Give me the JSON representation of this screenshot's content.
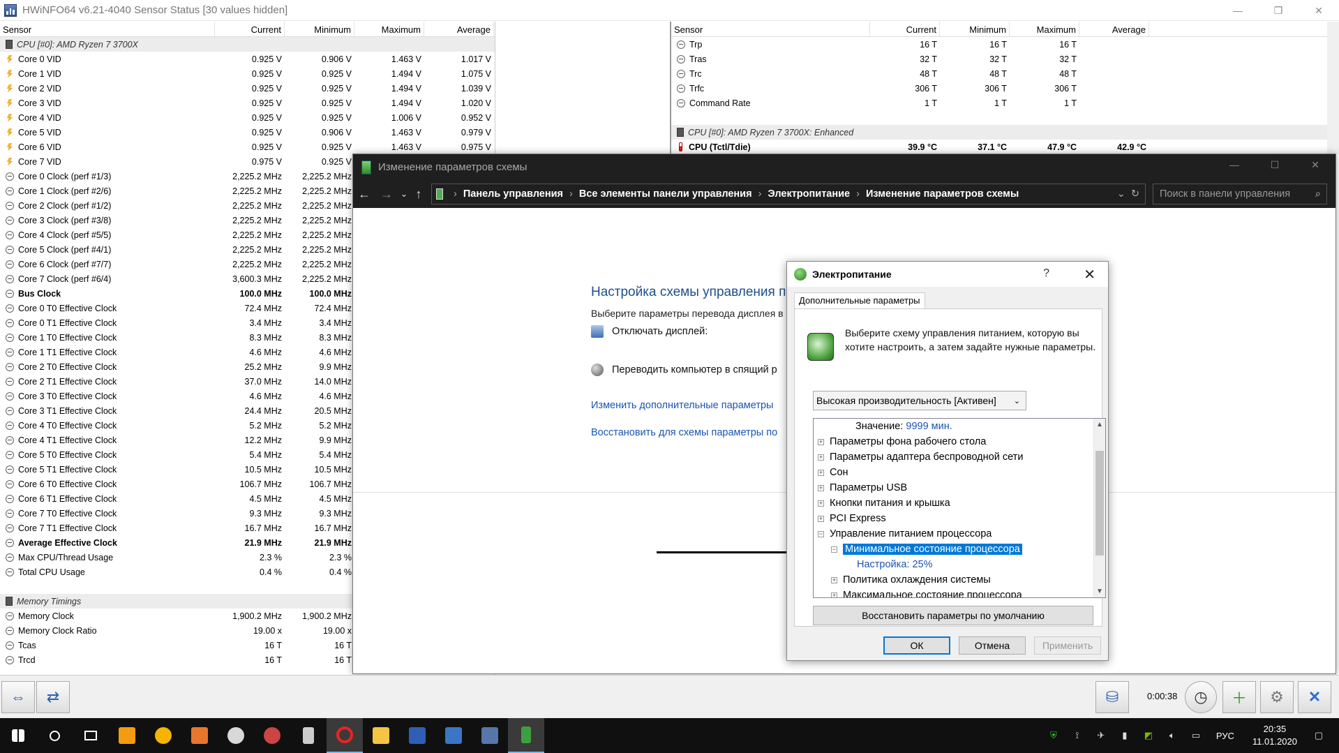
{
  "hwinfo": {
    "title": "HWiNFO64 v6.21-4040 Sensor Status [30 values hidden]",
    "headers": [
      "Sensor",
      "Current",
      "Minimum",
      "Maximum",
      "Average"
    ],
    "left_rows": [
      {
        "kind": "group",
        "icon": "chip",
        "name": "CPU [#0]: AMD Ryzen 7 3700X",
        "cur": "",
        "min": "",
        "max": "",
        "avg": ""
      },
      {
        "kind": "row",
        "icon": "bolt",
        "name": "Core 0 VID",
        "cur": "0.925 V",
        "min": "0.906 V",
        "max": "1.463 V",
        "avg": "1.017 V"
      },
      {
        "kind": "row",
        "icon": "bolt",
        "name": "Core 1 VID",
        "cur": "0.925 V",
        "min": "0.925 V",
        "max": "1.494 V",
        "avg": "1.075 V"
      },
      {
        "kind": "row",
        "icon": "bolt",
        "name": "Core 2 VID",
        "cur": "0.925 V",
        "min": "0.925 V",
        "max": "1.494 V",
        "avg": "1.039 V"
      },
      {
        "kind": "row",
        "icon": "bolt",
        "name": "Core 3 VID",
        "cur": "0.925 V",
        "min": "0.925 V",
        "max": "1.494 V",
        "avg": "1.020 V"
      },
      {
        "kind": "row",
        "icon": "bolt",
        "name": "Core 4 VID",
        "cur": "0.925 V",
        "min": "0.925 V",
        "max": "1.006 V",
        "avg": "0.952 V"
      },
      {
        "kind": "row",
        "icon": "bolt",
        "name": "Core 5 VID",
        "cur": "0.925 V",
        "min": "0.906 V",
        "max": "1.463 V",
        "avg": "0.979 V"
      },
      {
        "kind": "row",
        "icon": "bolt",
        "name": "Core 6 VID",
        "cur": "0.925 V",
        "min": "0.925 V",
        "max": "1.463 V",
        "avg": "0.975 V"
      },
      {
        "kind": "row",
        "icon": "bolt",
        "name": "Core 7 VID",
        "cur": "0.975 V",
        "min": "0.925 V",
        "max": "",
        "avg": ""
      },
      {
        "kind": "row",
        "icon": "clock",
        "name": "Core 0 Clock (perf #1/3)",
        "cur": "2,225.2 MHz",
        "min": "2,225.2 MHz",
        "max": "",
        "avg": ""
      },
      {
        "kind": "row",
        "icon": "clock",
        "name": "Core 1 Clock (perf #2/6)",
        "cur": "2,225.2 MHz",
        "min": "2,225.2 MHz",
        "max": "",
        "avg": ""
      },
      {
        "kind": "row",
        "icon": "clock",
        "name": "Core 2 Clock (perf #1/2)",
        "cur": "2,225.2 MHz",
        "min": "2,225.2 MHz",
        "max": "",
        "avg": ""
      },
      {
        "kind": "row",
        "icon": "clock",
        "name": "Core 3 Clock (perf #3/8)",
        "cur": "2,225.2 MHz",
        "min": "2,225.2 MHz",
        "max": "",
        "avg": ""
      },
      {
        "kind": "row",
        "icon": "clock",
        "name": "Core 4 Clock (perf #5/5)",
        "cur": "2,225.2 MHz",
        "min": "2,225.2 MHz",
        "max": "",
        "avg": ""
      },
      {
        "kind": "row",
        "icon": "clock",
        "name": "Core 5 Clock (perf #4/1)",
        "cur": "2,225.2 MHz",
        "min": "2,225.2 MHz",
        "max": "",
        "avg": ""
      },
      {
        "kind": "row",
        "icon": "clock",
        "name": "Core 6 Clock (perf #7/7)",
        "cur": "2,225.2 MHz",
        "min": "2,225.2 MHz",
        "max": "",
        "avg": ""
      },
      {
        "kind": "row",
        "icon": "clock",
        "name": "Core 7 Clock (perf #6/4)",
        "cur": "3,600.3 MHz",
        "min": "2,225.2 MHz",
        "max": "",
        "avg": ""
      },
      {
        "kind": "bold",
        "icon": "clock",
        "name": "Bus Clock",
        "cur": "100.0 MHz",
        "min": "100.0 MHz",
        "max": "",
        "avg": ""
      },
      {
        "kind": "row",
        "icon": "clock",
        "name": "Core 0 T0 Effective Clock",
        "cur": "72.4 MHz",
        "min": "72.4 MHz",
        "max": "",
        "avg": ""
      },
      {
        "kind": "row",
        "icon": "clock",
        "name": "Core 0 T1 Effective Clock",
        "cur": "3.4 MHz",
        "min": "3.4 MHz",
        "max": "",
        "avg": ""
      },
      {
        "kind": "row",
        "icon": "clock",
        "name": "Core 1 T0 Effective Clock",
        "cur": "8.3 MHz",
        "min": "8.3 MHz",
        "max": "",
        "avg": ""
      },
      {
        "kind": "row",
        "icon": "clock",
        "name": "Core 1 T1 Effective Clock",
        "cur": "4.6 MHz",
        "min": "4.6 MHz",
        "max": "",
        "avg": ""
      },
      {
        "kind": "row",
        "icon": "clock",
        "name": "Core 2 T0 Effective Clock",
        "cur": "25.2 MHz",
        "min": "9.9 MHz",
        "max": "",
        "avg": ""
      },
      {
        "kind": "row",
        "icon": "clock",
        "name": "Core 2 T1 Effective Clock",
        "cur": "37.0 MHz",
        "min": "14.0 MHz",
        "max": "",
        "avg": ""
      },
      {
        "kind": "row",
        "icon": "clock",
        "name": "Core 3 T0 Effective Clock",
        "cur": "4.6 MHz",
        "min": "4.6 MHz",
        "max": "",
        "avg": ""
      },
      {
        "kind": "row",
        "icon": "clock",
        "name": "Core 3 T1 Effective Clock",
        "cur": "24.4 MHz",
        "min": "20.5 MHz",
        "max": "",
        "avg": ""
      },
      {
        "kind": "row",
        "icon": "clock",
        "name": "Core 4 T0 Effective Clock",
        "cur": "5.2 MHz",
        "min": "5.2 MHz",
        "max": "",
        "avg": ""
      },
      {
        "kind": "row",
        "icon": "clock",
        "name": "Core 4 T1 Effective Clock",
        "cur": "12.2 MHz",
        "min": "9.9 MHz",
        "max": "",
        "avg": ""
      },
      {
        "kind": "row",
        "icon": "clock",
        "name": "Core 5 T0 Effective Clock",
        "cur": "5.4 MHz",
        "min": "5.4 MHz",
        "max": "",
        "avg": ""
      },
      {
        "kind": "row",
        "icon": "clock",
        "name": "Core 5 T1 Effective Clock",
        "cur": "10.5 MHz",
        "min": "10.5 MHz",
        "max": "",
        "avg": ""
      },
      {
        "kind": "row",
        "icon": "clock",
        "name": "Core 6 T0 Effective Clock",
        "cur": "106.7 MHz",
        "min": "106.7 MHz",
        "max": "",
        "avg": ""
      },
      {
        "kind": "row",
        "icon": "clock",
        "name": "Core 6 T1 Effective Clock",
        "cur": "4.5 MHz",
        "min": "4.5 MHz",
        "max": "",
        "avg": ""
      },
      {
        "kind": "row",
        "icon": "clock",
        "name": "Core 7 T0 Effective Clock",
        "cur": "9.3 MHz",
        "min": "9.3 MHz",
        "max": "",
        "avg": ""
      },
      {
        "kind": "row",
        "icon": "clock",
        "name": "Core 7 T1 Effective Clock",
        "cur": "16.7 MHz",
        "min": "16.7 MHz",
        "max": "",
        "avg": ""
      },
      {
        "kind": "bold",
        "icon": "clock",
        "name": "Average Effective Clock",
        "cur": "21.9 MHz",
        "min": "21.9 MHz",
        "max": "",
        "avg": ""
      },
      {
        "kind": "row",
        "icon": "clock",
        "name": "Max CPU/Thread Usage",
        "cur": "2.3 %",
        "min": "2.3 %",
        "max": "",
        "avg": ""
      },
      {
        "kind": "row",
        "icon": "clock",
        "name": "Total CPU Usage",
        "cur": "0.4 %",
        "min": "0.4 %",
        "max": "",
        "avg": ""
      },
      {
        "kind": "blank",
        "icon": "",
        "name": "",
        "cur": "",
        "min": "",
        "max": "",
        "avg": ""
      },
      {
        "kind": "group",
        "icon": "chip",
        "name": "Memory Timings",
        "cur": "",
        "min": "",
        "max": "",
        "avg": ""
      },
      {
        "kind": "row",
        "icon": "clock",
        "name": "Memory Clock",
        "cur": "1,900.2 MHz",
        "min": "1,900.2 MHz",
        "max": "",
        "avg": ""
      },
      {
        "kind": "row",
        "icon": "clock",
        "name": "Memory Clock Ratio",
        "cur": "19.00 x",
        "min": "19.00 x",
        "max": "",
        "avg": ""
      },
      {
        "kind": "row",
        "icon": "clock",
        "name": "Tcas",
        "cur": "16 T",
        "min": "16 T",
        "max": "",
        "avg": ""
      },
      {
        "kind": "row",
        "icon": "clock",
        "name": "Trcd",
        "cur": "16 T",
        "min": "16 T",
        "max": "",
        "avg": ""
      }
    ],
    "right_rows": [
      {
        "kind": "row",
        "icon": "clock",
        "name": "Trp",
        "cur": "16 T",
        "min": "16 T",
        "max": "16 T",
        "avg": ""
      },
      {
        "kind": "row",
        "icon": "clock",
        "name": "Tras",
        "cur": "32 T",
        "min": "32 T",
        "max": "32 T",
        "avg": ""
      },
      {
        "kind": "row",
        "icon": "clock",
        "name": "Trc",
        "cur": "48 T",
        "min": "48 T",
        "max": "48 T",
        "avg": ""
      },
      {
        "kind": "row",
        "icon": "clock",
        "name": "Trfc",
        "cur": "306 T",
        "min": "306 T",
        "max": "306 T",
        "avg": ""
      },
      {
        "kind": "row",
        "icon": "clock",
        "name": "Command Rate",
        "cur": "1 T",
        "min": "1 T",
        "max": "1 T",
        "avg": ""
      },
      {
        "kind": "blank",
        "icon": "",
        "name": "",
        "cur": "",
        "min": "",
        "max": "",
        "avg": ""
      },
      {
        "kind": "group",
        "icon": "chip",
        "name": "CPU [#0]: AMD Ryzen 7 3700X: Enhanced",
        "cur": "",
        "min": "",
        "max": "",
        "avg": ""
      },
      {
        "kind": "bold",
        "icon": "therm",
        "name": "CPU (Tctl/Tdie)",
        "cur": "39.9 °C",
        "min": "37.1 °C",
        "max": "47.9 °C",
        "avg": "42.9 °C"
      }
    ],
    "status_time": "0:00:38"
  },
  "control_panel": {
    "title": "Изменение параметров схемы",
    "breadcrumb": [
      "Панель управления",
      "Все элементы панели управления",
      "Электропитание",
      "Изменение параметров схемы"
    ],
    "search_placeholder": "Поиск в панели управления",
    "heading": "Настройка схемы управления питанием \"Высокая производительность\"",
    "subheading": "Выберите параметры перевода дисплея в спящий режим.",
    "opt_display": "Отключать дисплей:",
    "opt_sleep": "Переводить компьютер в спящий р",
    "link_advanced": "Изменить дополнительные параметры",
    "link_restore": "Восстановить для схемы параметры по"
  },
  "power_dialog": {
    "title": "Электропитание",
    "help": "?",
    "tab": "Дополнительные параметры",
    "description": "Выберите схему управления питанием, которую вы хотите настроить, а затем задайте нужные параметры.",
    "plan": "Высокая производительность [Активен]",
    "tree": {
      "value_label": "Значение:",
      "value": "9999 мин.",
      "items": [
        "Параметры фона рабочего стола",
        "Параметры адаптера беспроводной сети",
        "Сон",
        "Параметры USB",
        "Кнопки питания и крышка",
        "PCI Express",
        "Управление питанием процессора"
      ],
      "selected": "Минимальное состояние процессора",
      "setting": "Настройка: 25%",
      "after": "Политика охлаждения системы",
      "cut": "Максимальное состояние процессора"
    },
    "restore_btn": "Восстановить параметры по умолчанию",
    "ok": "ОК",
    "cancel": "Отмена",
    "apply": "Применить"
  },
  "taskbar": {
    "lang": "РУС",
    "time": "20:35",
    "date": "11.01.2020"
  }
}
